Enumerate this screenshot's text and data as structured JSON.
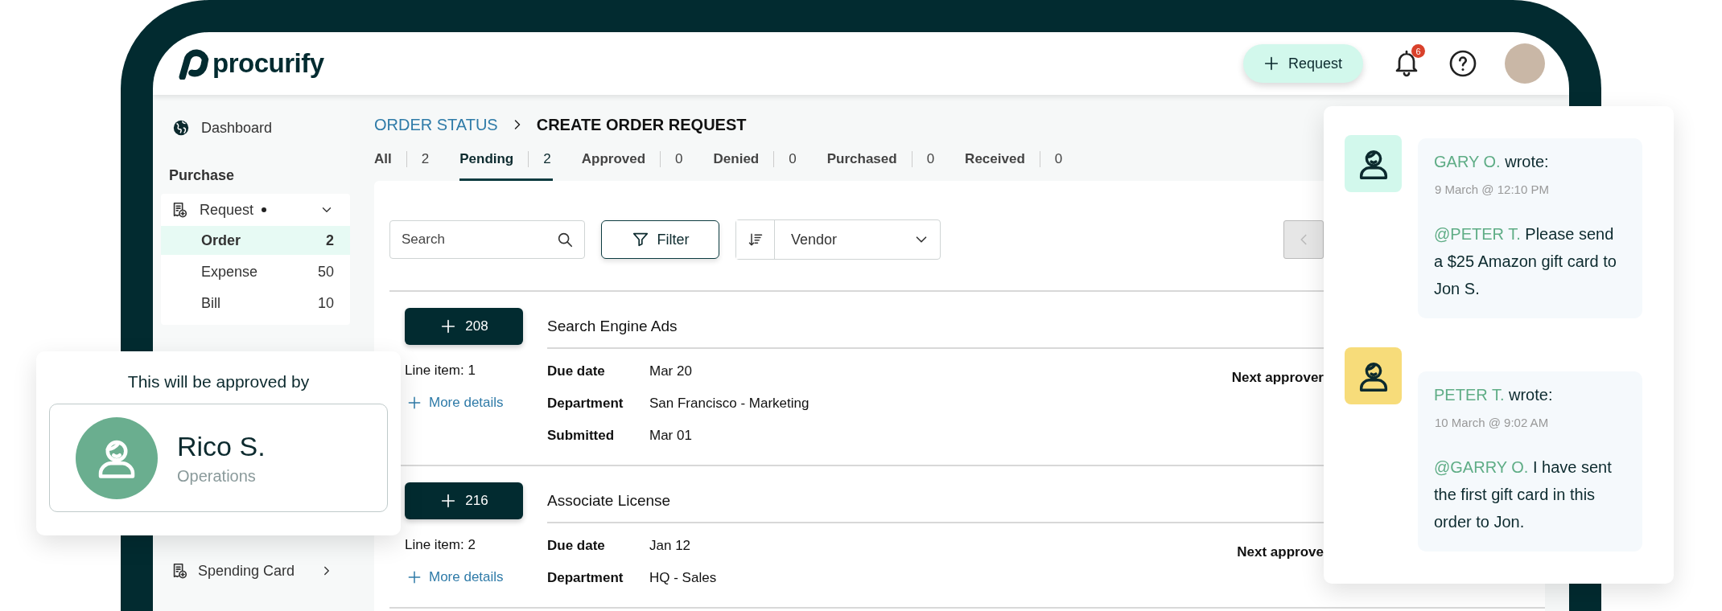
{
  "header": {
    "logo": "procurify",
    "request_button": "Request",
    "notification_count": "6"
  },
  "sidebar": {
    "dashboard": "Dashboard",
    "section": "Purchase",
    "groups": [
      {
        "label": "Request",
        "dot": true,
        "expanded": true,
        "children": [
          {
            "label": "Order",
            "count": "2",
            "selected": true
          },
          {
            "label": "Expense",
            "count": "50",
            "selected": false
          },
          {
            "label": "Bill",
            "count": "10",
            "selected": false
          }
        ]
      },
      {
        "label": "Spending Card",
        "dot": false,
        "expanded": false
      }
    ]
  },
  "breadcrumb": [
    "ORDER STATUS",
    "CREATE ORDER REQUEST"
  ],
  "tabs": [
    {
      "label": "All",
      "count": "2",
      "selected": false
    },
    {
      "label": "Pending",
      "count": "2",
      "selected": true
    },
    {
      "label": "Approved",
      "count": "0",
      "selected": false
    },
    {
      "label": "Denied",
      "count": "0",
      "selected": false
    },
    {
      "label": "Purchased",
      "count": "0",
      "selected": false
    },
    {
      "label": "Received",
      "count": "0",
      "selected": false
    }
  ],
  "toolbar": {
    "search": {
      "placeholder": "Search"
    },
    "filter": "Filter",
    "sort": "Vendor",
    "prev_disabled": true
  },
  "orders": [
    {
      "number": "208",
      "title": "Search Engine Ads",
      "line_item": "Line item: 1",
      "more": "More details",
      "next_approver": "Next approver",
      "fields": [
        {
          "label": "Due date",
          "value": "Mar 20"
        },
        {
          "label": "Department",
          "value": "San Francisco - Marketing"
        },
        {
          "label": "Submitted",
          "value": "Mar 01"
        }
      ]
    },
    {
      "number": "216",
      "title": "Associate License",
      "line_item": "Line item: 2",
      "more": "More details",
      "next_approver": "Next approve",
      "fields": [
        {
          "label": "Due date",
          "value": "Jan 12"
        },
        {
          "label": "Department",
          "value": "HQ - Sales"
        }
      ]
    }
  ],
  "approval_card": {
    "title": "This will be approved by",
    "name": "Rico S.",
    "department": "Operations"
  },
  "comments": [
    {
      "author": "GARY O.",
      "wrote": "wrote:",
      "time": "9 March @ 12:10 PM",
      "mention": "@PETER T.",
      "message": "Please send a $25 Amazon gift card to Jon S.",
      "color": "#d2f8ec"
    },
    {
      "author": "PETER T.",
      "wrote": "wrote:",
      "time": "10 March @ 9:02 AM",
      "mention": "@GARRY O.",
      "message": "I have sent the first gift card in this order to Jon.",
      "color": "#f7dc7a"
    }
  ]
}
